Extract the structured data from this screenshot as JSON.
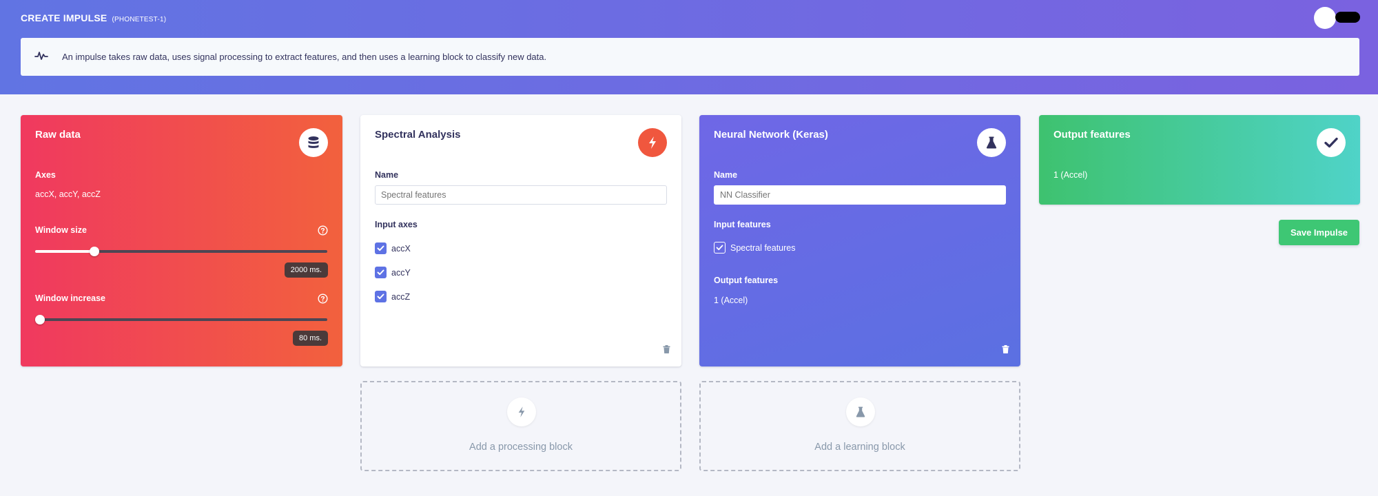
{
  "header": {
    "title": "CREATE IMPULSE",
    "project": "(PHONETEST-1)"
  },
  "info": {
    "text": "An impulse takes raw data, uses signal processing to extract features, and then uses a learning block to classify new data."
  },
  "raw_data": {
    "title": "Raw data",
    "axes_label": "Axes",
    "axes_value": "accX, accY, accZ",
    "window_size_label": "Window size",
    "window_size_value": "2000 ms.",
    "window_size_fraction": 0.2,
    "window_increase_label": "Window increase",
    "window_increase_value": "80 ms.",
    "window_increase_fraction": 0.0
  },
  "spectral": {
    "title": "Spectral Analysis",
    "name_label": "Name",
    "name_placeholder": "Spectral features",
    "input_axes_label": "Input axes",
    "axes": [
      "accX",
      "accY",
      "accZ"
    ]
  },
  "nn": {
    "title": "Neural Network (Keras)",
    "name_label": "Name",
    "name_placeholder": "NN Classifier",
    "input_features_label": "Input features",
    "input_feature": "Spectral features",
    "output_features_label": "Output features",
    "output_features_value": "1 (Accel)"
  },
  "output": {
    "title": "Output features",
    "value": "1 (Accel)"
  },
  "save_button": "Save Impulse",
  "add_processing": "Add a processing block",
  "add_learning": "Add a learning block",
  "icons": {
    "raw_data": "database-icon",
    "spectral": "lightning-icon",
    "nn": "flask-icon",
    "output": "checkmark-icon",
    "info": "pulse-icon"
  },
  "colors": {
    "header_start": "#6174e3",
    "header_end": "#7a62e0",
    "raw_start": "#f0395f",
    "raw_end": "#f2613d",
    "spectral_icon": "#f0573e",
    "nn": "#6a6ae5",
    "output_start": "#3ec26f",
    "output_end": "#4fd3c8",
    "save": "#3ec774"
  }
}
